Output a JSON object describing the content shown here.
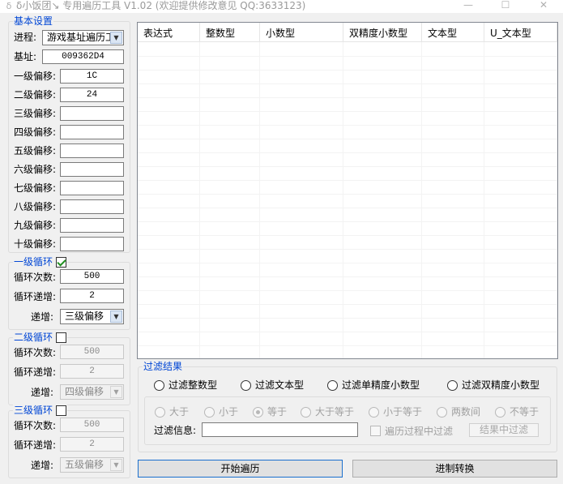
{
  "window": {
    "title": "δ小饭团↘ 专用遍历工具 V1.02 (欢迎提供修改意见 QQ:3633123)",
    "icon": "app-icon",
    "min_glyph": "—",
    "max_glyph": "☐",
    "close_glyph": "✕"
  },
  "basic": {
    "title": "基本设置",
    "process_label": "进程:",
    "process_value": "游戏基址遍历工",
    "base_label": "基址:",
    "base_value": "009362D4",
    "offsets": [
      {
        "label": "一级偏移:",
        "value": "1C"
      },
      {
        "label": "二级偏移:",
        "value": "24"
      },
      {
        "label": "三级偏移:",
        "value": ""
      },
      {
        "label": "四级偏移:",
        "value": ""
      },
      {
        "label": "五级偏移:",
        "value": ""
      },
      {
        "label": "六级偏移:",
        "value": ""
      },
      {
        "label": "七级偏移:",
        "value": ""
      },
      {
        "label": "八级偏移:",
        "value": ""
      },
      {
        "label": "九级偏移:",
        "value": ""
      },
      {
        "label": "十级偏移:",
        "value": ""
      }
    ]
  },
  "loops": [
    {
      "title": "一级循环",
      "checked": true,
      "count_label": "循环次数:",
      "count_value": "500",
      "step_label": "循环递增:",
      "step_value": "2",
      "inc_label": "递增:",
      "inc_value": "三级偏移"
    },
    {
      "title": "二级循环",
      "checked": false,
      "count_label": "循环次数:",
      "count_value": "500",
      "step_label": "循环递增:",
      "step_value": "2",
      "inc_label": "递增:",
      "inc_value": "四级偏移"
    },
    {
      "title": "三级循环",
      "checked": false,
      "count_label": "循环次数:",
      "count_value": "500",
      "step_label": "循环递增:",
      "step_value": "2",
      "inc_label": "递增:",
      "inc_value": "五级偏移"
    }
  ],
  "results": {
    "columns": [
      "表达式",
      "整数型",
      "小数型",
      "双精度小数型",
      "文本型",
      "U_文本型"
    ]
  },
  "filter": {
    "title": "过滤结果",
    "types": [
      "过滤整数型",
      "过滤文本型",
      "过滤单精度小数型",
      "过滤双精度小数型"
    ],
    "compare": [
      "大于",
      "小于",
      "等于",
      "大于等于",
      "小于等于",
      "两数间",
      "不等于"
    ],
    "selected_compare": "等于",
    "info_label": "过滤信息:",
    "info_value": "",
    "during_label": "遍历过程中过滤",
    "result_filter_label": "结果中过滤"
  },
  "actions": {
    "start_label": "开始遍历",
    "convert_label": "进制转换"
  }
}
